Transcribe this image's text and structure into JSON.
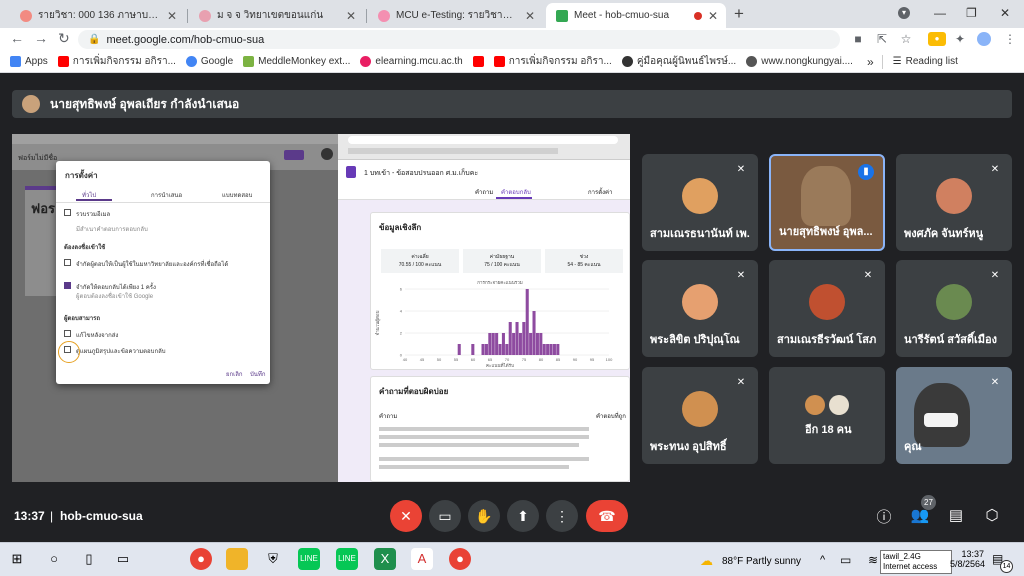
{
  "browser": {
    "tabs": [
      {
        "title": "รายวิชา: 000 136 ภาษาบาลี-ตร.ภูมิศ",
        "color": "#f28b82"
      },
      {
        "title": "ม จ จ วิทยาเขตขอนแก่น",
        "color": "#e8a0b0"
      },
      {
        "title": "MCU e-Testing: รายวิชาทั้งหมด",
        "color": "#f48fb1"
      },
      {
        "title": "Meet - hob-cmuo-sua",
        "color": "#34a853"
      }
    ],
    "new_tab": "+",
    "url": "meet.google.com/hob-cmuo-sua",
    "bookmarks": [
      {
        "label": "Apps",
        "color": "#4285f4"
      },
      {
        "label": "การเพิ่มกิจกรรม อกิรา...",
        "color": "#ff0000"
      },
      {
        "label": "Google",
        "color": "#4285f4"
      },
      {
        "label": "MeddleMonkey ext...",
        "color": "#7cb342"
      },
      {
        "label": "elearning.mcu.ac.th",
        "color": "#e91e63"
      },
      {
        "label": "",
        "color": "#ff0000"
      },
      {
        "label": "การเพิ่มกิจกรรม อกิรา...",
        "color": "#ff0000"
      },
      {
        "label": "คู่มือคุณผู้นิพนธ์ไพรษ์...",
        "color": "#333333"
      },
      {
        "label": "www.nongkungyai....",
        "color": "#555555"
      }
    ],
    "reading_list": "Reading list"
  },
  "meet": {
    "presenter_label": "นายสุทธิพงษ์ อุพลเถียร กำลังนำเสนอ",
    "meeting_time": "13:37",
    "meeting_code": "hob-cmuo-sua",
    "participants_count": "27",
    "tiles": [
      {
        "name": "สามเณรธนานันท์ เพ...",
        "muted": true,
        "color": "#e0a060"
      },
      {
        "name": "นายสุทธิพงษ์ อุพล...",
        "muted": false,
        "speaking": true,
        "color": "#8a6a50"
      },
      {
        "name": "พงศภัค จันทร์หนู",
        "muted": true,
        "color": "#d08060"
      },
      {
        "name": "พระลิขิต ปริปุณฺโณ",
        "muted": true,
        "color": "#e6a070"
      },
      {
        "name": "สามเณรธีรวัฒน์ โสภ...",
        "muted": true,
        "color": "#c05030"
      },
      {
        "name": "นารีรัตน์ สวัสดิ์เมือง",
        "muted": true,
        "color": "#6a8a50"
      },
      {
        "name": "พระทนง อุปสิทธิ์",
        "muted": true,
        "color": "#d09050"
      },
      {
        "name": "อีก 18 คน",
        "muted": false,
        "color": "#888888"
      },
      {
        "name": "คุณ",
        "muted": true,
        "color": "#4a6a8a"
      }
    ]
  },
  "shared": {
    "form_title": "ฟอร์มไม่มีชื่อ",
    "form_heading": "ฟอร",
    "dialog_title": "การตั้งค่า",
    "dialog_tabs": [
      "ทั่วไป",
      "การนำเสนอ",
      "แบบทดสอบ"
    ],
    "dialog_opt1": "รวบรวมอีเมล",
    "dialog_opt1_sub": "มีสำเนาคำตอบการตอบกลับ",
    "dialog_section2": "ต้องลงชื่อเข้าใช้",
    "dialog_opt2": "จำกัดผู้ตอบให้เป็นผู้ใช้ในมหาวิทยาลัยและองค์กรที่เชื่อถือได้",
    "dialog_opt3": "จำกัดให้ตอบกลับได้เพียง 1 ครั้ง",
    "dialog_opt3_sub": "ผู้ตอบต้องลงชื่อเข้าใช้ Google",
    "dialog_section3": "ผู้ตอบสามารถ",
    "dialog_opt4": "แก้ไขหลังจากส่ง",
    "dialog_opt5": "ดูแผนภูมิสรุปและข้อความตอบกลับ",
    "dialog_cancel": "ยกเลิก",
    "dialog_save": "บันทึก",
    "doc_title": "1 บทเข้า - ข้อสอบปรนออก ศ.ม.เก็บคะ",
    "doc_tabs": [
      "คำถาม",
      "คำตอบกลับ",
      "การตั้งค่า"
    ],
    "doc_section": "ข้อมูลเชิงลึก",
    "stats": [
      {
        "label": "ค่าเฉลี่ย",
        "value": "70.55 / 100 คะแนน"
      },
      {
        "label": "ค่ามัธยฐาน",
        "value": "75 / 100 คะแนน"
      },
      {
        "label": "ช่วง",
        "value": "54 - 85 คะแนน"
      }
    ],
    "chart_title": "การกระจายคะแนนรวม",
    "chart_xlabel": "คะแนนที่ได้รับ",
    "chart_ylabel": "จำนวนผู้ตอบ",
    "missed_title": "คำถามที่ตอบผิดบ่อย",
    "missed_col1": "คำถาม",
    "missed_col2": "คำตอบที่ถูก"
  },
  "chart_data": {
    "type": "bar",
    "xlim": [
      40,
      100
    ],
    "ylim": [
      0,
      6
    ],
    "x": [
      56,
      60,
      63,
      64,
      65,
      66,
      67,
      68,
      69,
      70,
      71,
      72,
      73,
      74,
      75,
      76,
      77,
      78,
      79,
      80,
      81,
      82,
      83,
      84,
      85
    ],
    "values": [
      1,
      1,
      1,
      1,
      2,
      2,
      2,
      1,
      2,
      1,
      3,
      2,
      3,
      2,
      3,
      6,
      2,
      4,
      2,
      2,
      1,
      1,
      1,
      1,
      1
    ],
    "xticks": [
      "40",
      "45",
      "50",
      "55",
      "60",
      "65",
      "70",
      "75",
      "80",
      "85",
      "90",
      "95",
      "100"
    ],
    "yticks": [
      "0",
      "2",
      "4",
      "6"
    ]
  },
  "taskbar": {
    "weather": "88°F  Partly sunny",
    "time": "13:37",
    "date": "5/8/2564",
    "notif": "14",
    "tooltip_line1": "tawil_2.4G",
    "tooltip_line2": "Internet access"
  }
}
